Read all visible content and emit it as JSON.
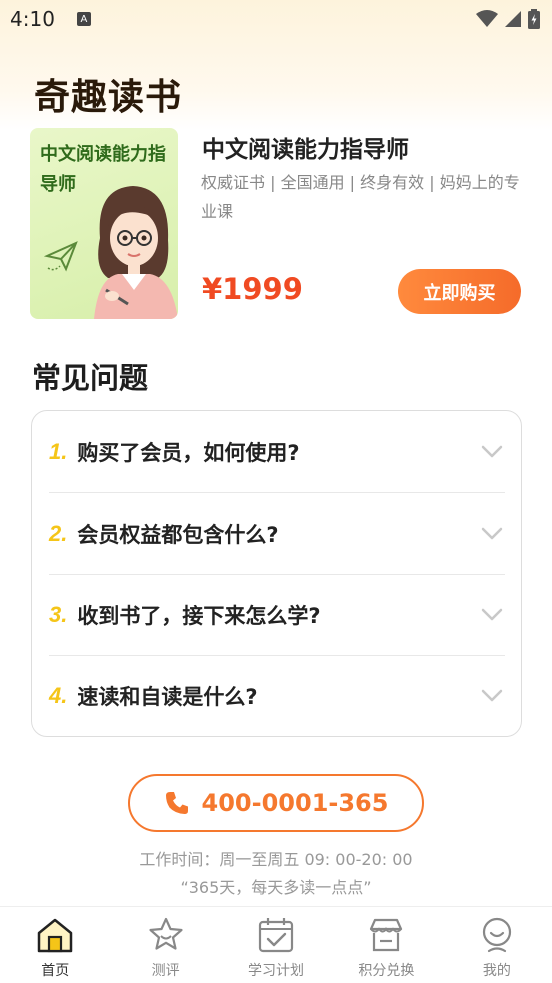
{
  "status_bar": {
    "time": "4:10",
    "notification_icon": "A"
  },
  "app": {
    "title": "奇趣读书"
  },
  "product": {
    "cover_title": "中文阅读能力指导师",
    "name": "中文阅读能力指导师",
    "description": "权威证书 | 全国通用 | 终身有效 | 妈妈上的专业课",
    "price": "¥1999",
    "buy_label": "立即购买"
  },
  "faq": {
    "title": "常见问题",
    "items": [
      {
        "num": "1.",
        "question": "购买了会员，如何使用?"
      },
      {
        "num": "2.",
        "question": "会员权益都包含什么?"
      },
      {
        "num": "3.",
        "question": "收到书了，接下来怎么学?"
      },
      {
        "num": "4.",
        "question": "速读和自读是什么?"
      }
    ]
  },
  "contact": {
    "phone": "400-0001-365",
    "hours": "工作时间：周一至周五 09: 00-20: 00",
    "slogan": "“365天，每天多读一点点”"
  },
  "tabs": [
    {
      "label": "首页",
      "icon": "home-icon",
      "active": true
    },
    {
      "label": "测评",
      "icon": "star-icon",
      "active": false
    },
    {
      "label": "学习计划",
      "icon": "calendar-check-icon",
      "active": false
    },
    {
      "label": "积分兑换",
      "icon": "store-icon",
      "active": false
    },
    {
      "label": "我的",
      "icon": "profile-icon",
      "active": false
    }
  ],
  "colors": {
    "accent": "#f5782e",
    "price": "#f04a22",
    "faq_number": "#f5c518"
  }
}
